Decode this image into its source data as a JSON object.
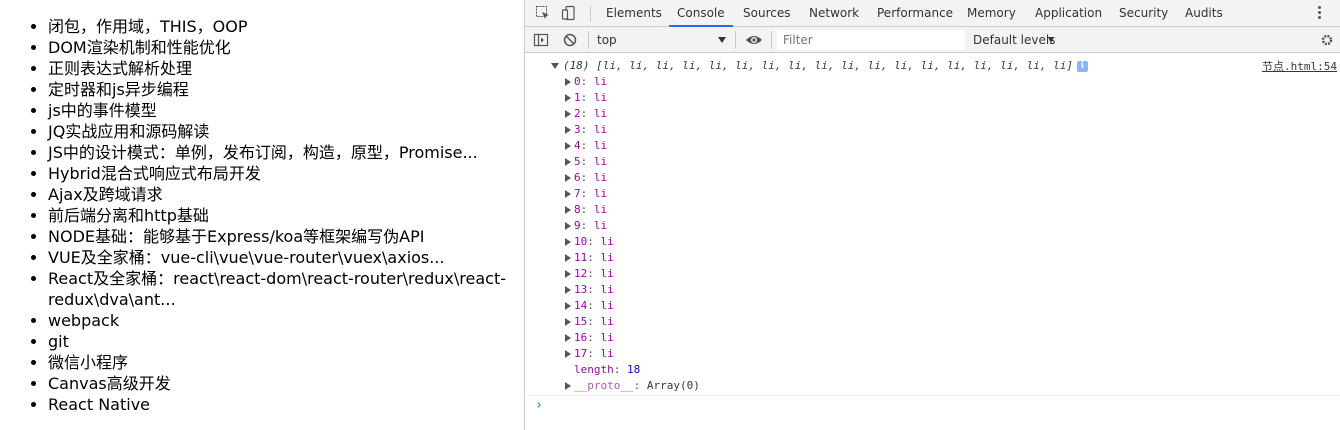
{
  "page": {
    "items": [
      "闭包，作用域，THIS，OOP",
      "DOM渲染机制和性能优化",
      "正则表达式解析处理",
      "定时器和js异步编程",
      "js中的事件模型",
      "JQ实战应用和源码解读",
      "JS中的设计模式：单例，发布订阅，构造，原型，Promise...",
      "Hybrid混合式响应式布局开发",
      "Ajax及跨域请求",
      "前后端分离和http基础",
      "NODE基础：能够基于Express/koa等框架编写伪API",
      "VUE及全家桶：vue-cli\\vue\\vue-router\\vuex\\axios...",
      "React及全家桶：react\\react-dom\\react-router\\redux\\react-redux\\dva\\ant...",
      "webpack",
      "git",
      "微信小程序",
      "Canvas高级开发",
      "React Native"
    ]
  },
  "devtools": {
    "tabs": [
      "Elements",
      "Console",
      "Sources",
      "Network",
      "Performance",
      "Memory",
      "Application",
      "Security",
      "Audits"
    ],
    "active_tab": "Console",
    "context": "top",
    "filter_placeholder": "Filter",
    "levels": "Default levels",
    "log": {
      "summary": "(18) [li, li, li, li, li, li, li, li, li, li, li, li, li, li, li, li, li, li]",
      "info_badge": "i",
      "source": "节点.html:54",
      "entries": [
        {
          "key": "0",
          "val": "li"
        },
        {
          "key": "1",
          "val": "li"
        },
        {
          "key": "2",
          "val": "li"
        },
        {
          "key": "3",
          "val": "li"
        },
        {
          "key": "4",
          "val": "li"
        },
        {
          "key": "5",
          "val": "li"
        },
        {
          "key": "6",
          "val": "li"
        },
        {
          "key": "7",
          "val": "li"
        },
        {
          "key": "8",
          "val": "li"
        },
        {
          "key": "9",
          "val": "li"
        },
        {
          "key": "10",
          "val": "li"
        },
        {
          "key": "11",
          "val": "li"
        },
        {
          "key": "12",
          "val": "li"
        },
        {
          "key": "13",
          "val": "li"
        },
        {
          "key": "14",
          "val": "li"
        },
        {
          "key": "15",
          "val": "li"
        },
        {
          "key": "16",
          "val": "li"
        },
        {
          "key": "17",
          "val": "li"
        }
      ],
      "length_key": "length",
      "length_val": "18",
      "proto_key": "__proto__",
      "proto_val": "Array(0)"
    },
    "prompt": "›"
  },
  "colors": {
    "accent": "#1a73e8",
    "property_key": "#881391",
    "number": "#1c00cf"
  }
}
